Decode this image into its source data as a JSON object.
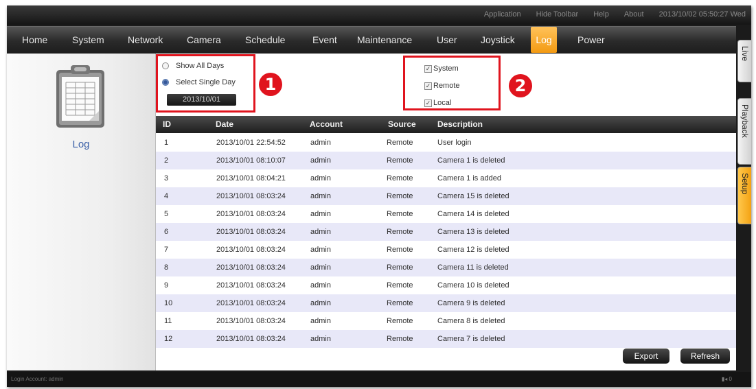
{
  "topbar": {
    "links": [
      "Application",
      "Hide Toolbar",
      "Help",
      "About"
    ],
    "datetime": "2013/10/02 05:50:27 Wed"
  },
  "nav": {
    "items": [
      "Home",
      "System",
      "Network",
      "Camera",
      "Schedule",
      "Event",
      "Maintenance",
      "User",
      "Joystick",
      "Log",
      "Power"
    ],
    "active": "Log"
  },
  "side_tabs": {
    "items": [
      "Live",
      "Playback",
      "Setup"
    ],
    "active": "Setup"
  },
  "sidebar": {
    "icon": "log-clipboard-icon",
    "label": "Log"
  },
  "filters": {
    "days": {
      "options": [
        "Show All Days",
        "Select Single Day"
      ],
      "selected": "Select Single Day",
      "date_value": "2013/10/01"
    },
    "sources": {
      "options": [
        "System",
        "Remote",
        "Local"
      ],
      "checked": [
        true,
        true,
        true
      ]
    },
    "badges": [
      "1",
      "2"
    ],
    "highlight_color": "#e0141e"
  },
  "table": {
    "columns": [
      "ID",
      "Date",
      "Account",
      "Source",
      "Description"
    ],
    "rows": [
      [
        "1",
        "2013/10/01 22:54:52",
        "admin",
        "Remote",
        "User login"
      ],
      [
        "2",
        "2013/10/01 08:10:07",
        "admin",
        "Remote",
        "Camera 1 is deleted"
      ],
      [
        "3",
        "2013/10/01 08:04:21",
        "admin",
        "Remote",
        "Camera 1 is added"
      ],
      [
        "4",
        "2013/10/01 08:03:24",
        "admin",
        "Remote",
        "Camera 15 is deleted"
      ],
      [
        "5",
        "2013/10/01 08:03:24",
        "admin",
        "Remote",
        "Camera 14 is deleted"
      ],
      [
        "6",
        "2013/10/01 08:03:24",
        "admin",
        "Remote",
        "Camera 13 is deleted"
      ],
      [
        "7",
        "2013/10/01 08:03:24",
        "admin",
        "Remote",
        "Camera 12 is deleted"
      ],
      [
        "8",
        "2013/10/01 08:03:24",
        "admin",
        "Remote",
        "Camera 11 is deleted"
      ],
      [
        "9",
        "2013/10/01 08:03:24",
        "admin",
        "Remote",
        "Camera 10 is deleted"
      ],
      [
        "10",
        "2013/10/01 08:03:24",
        "admin",
        "Remote",
        "Camera 9 is deleted"
      ],
      [
        "11",
        "2013/10/01 08:03:24",
        "admin",
        "Remote",
        "Camera 8 is deleted"
      ],
      [
        "12",
        "2013/10/01 08:03:24",
        "admin",
        "Remote",
        "Camera 7 is deleted"
      ]
    ]
  },
  "actions": {
    "export": "Export",
    "refresh": "Refresh"
  },
  "status": {
    "text": "Login Account: admin",
    "icon": "network-status-icon",
    "indicator": "0"
  },
  "colors": {
    "accent": "#f39a12",
    "row_alt": "#e8e8f8",
    "sidebar_label": "#3d62a8"
  }
}
